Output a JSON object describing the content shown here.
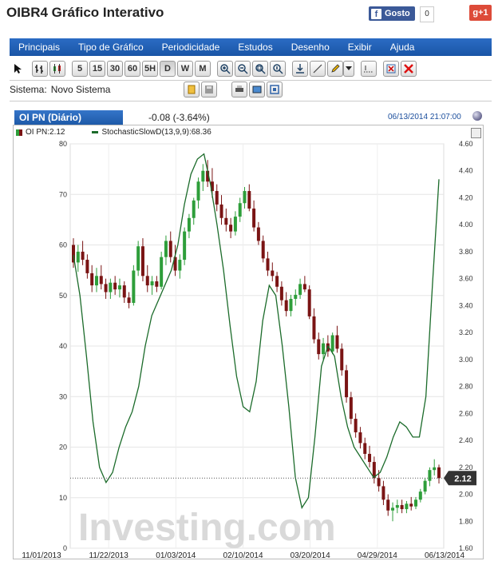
{
  "header": {
    "title": "OIBR4 Gráfico Interativo",
    "facebook_label": "Gosto",
    "facebook_count": "0",
    "gplus_label": "g+1"
  },
  "menu": {
    "items": [
      "Principais",
      "Tipo de Gráfico",
      "Periodicidade",
      "Estudos",
      "Desenho",
      "Exibir",
      "Ajuda"
    ]
  },
  "toolbar": {
    "periods": [
      "5",
      "15",
      "30",
      "60",
      "5H",
      "D",
      "W",
      "M"
    ],
    "active_period": "D"
  },
  "system": {
    "label": "Sistema:",
    "name": "Novo Sistema"
  },
  "chart_header": {
    "tab_label": "OI PN (Diário)",
    "change": "-0.08 (-3.64%)",
    "timestamp": "06/13/2014 21:07:00"
  },
  "legend": {
    "price": "OI PN:2.12",
    "indicator": "StochasticSlowD(13,9,9):68.36"
  },
  "chart_data": {
    "type": "line",
    "watermark": "Investing.com",
    "x_ticks": [
      "11/01/2013",
      "11/22/2013",
      "01/03/2014",
      "02/10/2014",
      "03/20/2014",
      "04/29/2014",
      "06/13/2014"
    ],
    "left_axis": {
      "ticks": [
        "0",
        "10",
        "20",
        "30",
        "40",
        "50",
        "60",
        "70",
        "80"
      ],
      "range": [
        0,
        80
      ]
    },
    "right_axis": {
      "ticks": [
        "1.60",
        "1.80",
        "2.00",
        "2.20",
        "2.40",
        "2.60",
        "2.80",
        "3.00",
        "3.20",
        "3.40",
        "3.60",
        "3.80",
        "4.00",
        "4.20",
        "4.40",
        "4.60"
      ],
      "range": [
        1.6,
        4.6
      ]
    },
    "last_price": "2.12",
    "last_price_value": 2.12,
    "colors": {
      "up": "#2e9e3a",
      "down": "#7a1414",
      "stoch": "#1b6b2a",
      "price_tag": "#333333"
    },
    "candles": [
      [
        3.85,
        3.9,
        3.68,
        3.72
      ],
      [
        3.72,
        3.85,
        3.65,
        3.8
      ],
      [
        3.8,
        3.88,
        3.7,
        3.74
      ],
      [
        3.74,
        3.78,
        3.6,
        3.64
      ],
      [
        3.64,
        3.7,
        3.5,
        3.55
      ],
      [
        3.55,
        3.68,
        3.5,
        3.62
      ],
      [
        3.62,
        3.7,
        3.52,
        3.56
      ],
      [
        3.56,
        3.6,
        3.45,
        3.5
      ],
      [
        3.5,
        3.6,
        3.45,
        3.57
      ],
      [
        3.57,
        3.62,
        3.48,
        3.52
      ],
      [
        3.52,
        3.6,
        3.46,
        3.55
      ],
      [
        3.55,
        3.58,
        3.42,
        3.46
      ],
      [
        3.46,
        3.5,
        3.38,
        3.42
      ],
      [
        3.42,
        3.7,
        3.4,
        3.66
      ],
      [
        3.66,
        3.88,
        3.62,
        3.84
      ],
      [
        3.84,
        3.9,
        3.58,
        3.62
      ],
      [
        3.62,
        3.7,
        3.5,
        3.55
      ],
      [
        3.55,
        3.62,
        3.48,
        3.58
      ],
      [
        3.58,
        3.62,
        3.5,
        3.54
      ],
      [
        3.54,
        3.8,
        3.52,
        3.76
      ],
      [
        3.76,
        3.92,
        3.7,
        3.88
      ],
      [
        3.88,
        3.95,
        3.72,
        3.76
      ],
      [
        3.76,
        3.85,
        3.62,
        3.66
      ],
      [
        3.66,
        3.78,
        3.6,
        3.74
      ],
      [
        3.74,
        3.98,
        3.7,
        3.95
      ],
      [
        3.95,
        4.08,
        3.9,
        4.05
      ],
      [
        4.05,
        4.2,
        4.0,
        4.18
      ],
      [
        4.18,
        4.35,
        4.12,
        4.32
      ],
      [
        4.32,
        4.45,
        4.25,
        4.4
      ],
      [
        4.4,
        4.48,
        4.28,
        4.32
      ],
      [
        4.32,
        4.42,
        4.2,
        4.25
      ],
      [
        4.25,
        4.3,
        4.1,
        4.15
      ],
      [
        4.15,
        4.22,
        4.0,
        4.05
      ],
      [
        4.05,
        4.12,
        3.95,
        4.0
      ],
      [
        4.0,
        4.05,
        3.9,
        3.95
      ],
      [
        3.95,
        4.1,
        3.92,
        4.06
      ],
      [
        4.06,
        4.2,
        4.02,
        4.16
      ],
      [
        4.16,
        4.28,
        4.12,
        4.25
      ],
      [
        4.25,
        4.3,
        4.1,
        4.12
      ],
      [
        4.12,
        4.18,
        3.95,
        3.98
      ],
      [
        3.98,
        4.02,
        3.85,
        3.88
      ],
      [
        3.88,
        3.92,
        3.72,
        3.75
      ],
      [
        3.75,
        3.8,
        3.62,
        3.66
      ],
      [
        3.66,
        3.72,
        3.58,
        3.62
      ],
      [
        3.62,
        3.65,
        3.5,
        3.54
      ],
      [
        3.54,
        3.58,
        3.4,
        3.44
      ],
      [
        3.44,
        3.5,
        3.32,
        3.36
      ],
      [
        3.36,
        3.48,
        3.32,
        3.45
      ],
      [
        3.45,
        3.52,
        3.4,
        3.48
      ],
      [
        3.48,
        3.6,
        3.45,
        3.56
      ],
      [
        3.56,
        3.62,
        3.5,
        3.52
      ],
      [
        3.52,
        3.55,
        3.3,
        3.32
      ],
      [
        3.32,
        3.38,
        3.12,
        3.15
      ],
      [
        3.15,
        3.2,
        3.0,
        3.04
      ],
      [
        3.04,
        3.16,
        3.0,
        3.12
      ],
      [
        3.12,
        3.18,
        3.02,
        3.06
      ],
      [
        3.06,
        3.2,
        3.04,
        3.18
      ],
      [
        3.18,
        3.25,
        3.05,
        3.08
      ],
      [
        3.08,
        3.12,
        2.88,
        2.92
      ],
      [
        2.92,
        2.96,
        2.68,
        2.72
      ],
      [
        2.72,
        2.76,
        2.52,
        2.56
      ],
      [
        2.56,
        2.6,
        2.42,
        2.46
      ],
      [
        2.46,
        2.5,
        2.34,
        2.38
      ],
      [
        2.38,
        2.42,
        2.26,
        2.3
      ],
      [
        2.3,
        2.36,
        2.2,
        2.24
      ],
      [
        2.24,
        2.28,
        2.08,
        2.12
      ],
      [
        2.12,
        2.18,
        2.02,
        2.06
      ],
      [
        2.06,
        2.1,
        1.92,
        1.96
      ],
      [
        1.96,
        2.0,
        1.84,
        1.88
      ],
      [
        1.88,
        1.94,
        1.8,
        1.9
      ],
      [
        1.9,
        1.96,
        1.86,
        1.92
      ],
      [
        1.92,
        1.96,
        1.86,
        1.89
      ],
      [
        1.89,
        1.95,
        1.86,
        1.93
      ],
      [
        1.93,
        1.98,
        1.88,
        1.91
      ],
      [
        1.91,
        1.98,
        1.89,
        1.96
      ],
      [
        1.96,
        2.04,
        1.94,
        2.02
      ],
      [
        2.02,
        2.12,
        2.0,
        2.1
      ],
      [
        2.1,
        2.2,
        2.06,
        2.18
      ],
      [
        2.18,
        2.26,
        2.14,
        2.2
      ],
      [
        2.2,
        2.22,
        2.08,
        2.12
      ]
    ],
    "stochastic": [
      [
        0,
        58
      ],
      [
        2,
        50
      ],
      [
        4,
        38
      ],
      [
        6,
        25
      ],
      [
        8,
        16
      ],
      [
        10,
        13
      ],
      [
        12,
        15
      ],
      [
        14,
        20
      ],
      [
        16,
        24
      ],
      [
        18,
        27
      ],
      [
        20,
        32
      ],
      [
        22,
        40
      ],
      [
        24,
        46
      ],
      [
        26,
        49
      ],
      [
        28,
        52
      ],
      [
        30,
        55
      ],
      [
        32,
        60
      ],
      [
        34,
        68
      ],
      [
        36,
        74
      ],
      [
        38,
        77
      ],
      [
        40,
        78
      ],
      [
        42,
        72
      ],
      [
        44,
        64
      ],
      [
        46,
        55
      ],
      [
        48,
        44
      ],
      [
        50,
        34
      ],
      [
        52,
        28
      ],
      [
        54,
        27
      ],
      [
        56,
        33
      ],
      [
        58,
        45
      ],
      [
        60,
        52
      ],
      [
        62,
        50
      ],
      [
        64,
        40
      ],
      [
        66,
        28
      ],
      [
        68,
        14
      ],
      [
        70,
        8
      ],
      [
        72,
        10
      ],
      [
        74,
        22
      ],
      [
        76,
        36
      ],
      [
        78,
        40
      ],
      [
        80,
        38
      ],
      [
        82,
        30
      ],
      [
        84,
        24
      ],
      [
        86,
        20
      ],
      [
        88,
        18
      ],
      [
        90,
        16
      ],
      [
        92,
        14
      ],
      [
        94,
        15
      ],
      [
        96,
        18
      ],
      [
        98,
        22
      ],
      [
        100,
        25
      ],
      [
        102,
        24
      ],
      [
        104,
        22
      ],
      [
        106,
        22
      ],
      [
        108,
        30
      ],
      [
        110,
        52
      ],
      [
        112,
        73
      ]
    ]
  }
}
